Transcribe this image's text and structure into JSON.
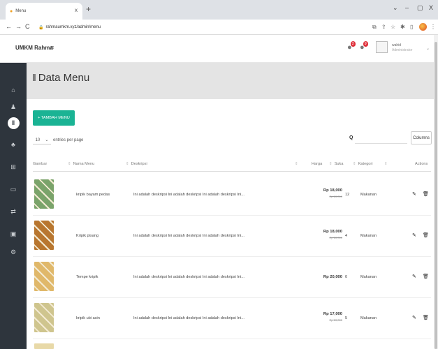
{
  "browser": {
    "tab_title": "Menu",
    "tab_close": "x",
    "new_tab": "+",
    "url": "rahmaumkm.xyz/admin/menu",
    "window_controls": [
      "⌄",
      "–",
      "▢",
      "X"
    ]
  },
  "app": {
    "brand": "UMKM Rahma",
    "notif_counts": [
      "2",
      "9"
    ],
    "user_name": "wahid",
    "user_role": "Administrator"
  },
  "page": {
    "title": "Data Menu",
    "add_button": "+ TAMBAH MENU",
    "entries_value": "10",
    "entries_label": "entries per page",
    "search_label": "Q",
    "columns_button": "Columns"
  },
  "table": {
    "headers": [
      "Gambar",
      "Nama Menu",
      "Deskripsi",
      "Harga",
      "Suka",
      "Kategori",
      "Actions"
    ],
    "rows": [
      {
        "name": "kripik bayam pedas",
        "desc": "Ini adalah deskripsi Ini adalah deskripsi Ini adalah deskripsi Ini...",
        "price": "Rp 18,000",
        "old_price": "Rp 20,000",
        "likes": "12",
        "category": "Makanan",
        "thumb": "#7aa36a"
      },
      {
        "name": "Kripik pisang",
        "desc": "Ini adalah deskripsi Ini adalah deskripsi Ini adalah deskripsi Ini...",
        "price": "Rp 18,000",
        "old_price": "Rp 20,000",
        "likes": "4",
        "category": "Makanan",
        "thumb": "#b8762f"
      },
      {
        "name": "Tempe kripik",
        "desc": "Ini adalah deskripsi Ini adalah deskripsi Ini adalah deskripsi Ini...",
        "price": "Rp 20,000",
        "old_price": "",
        "likes": "0",
        "category": "Makanan",
        "thumb": "#e0b86a"
      },
      {
        "name": "kripik ubi asin",
        "desc": "Ini adalah deskripsi Ini adalah deskripsi Ini adalah deskripsi Ini...",
        "price": "Rp 17,000",
        "old_price": "Rp 20,000",
        "likes": "5",
        "category": "Makanan",
        "thumb": "#cfc58e"
      }
    ]
  }
}
